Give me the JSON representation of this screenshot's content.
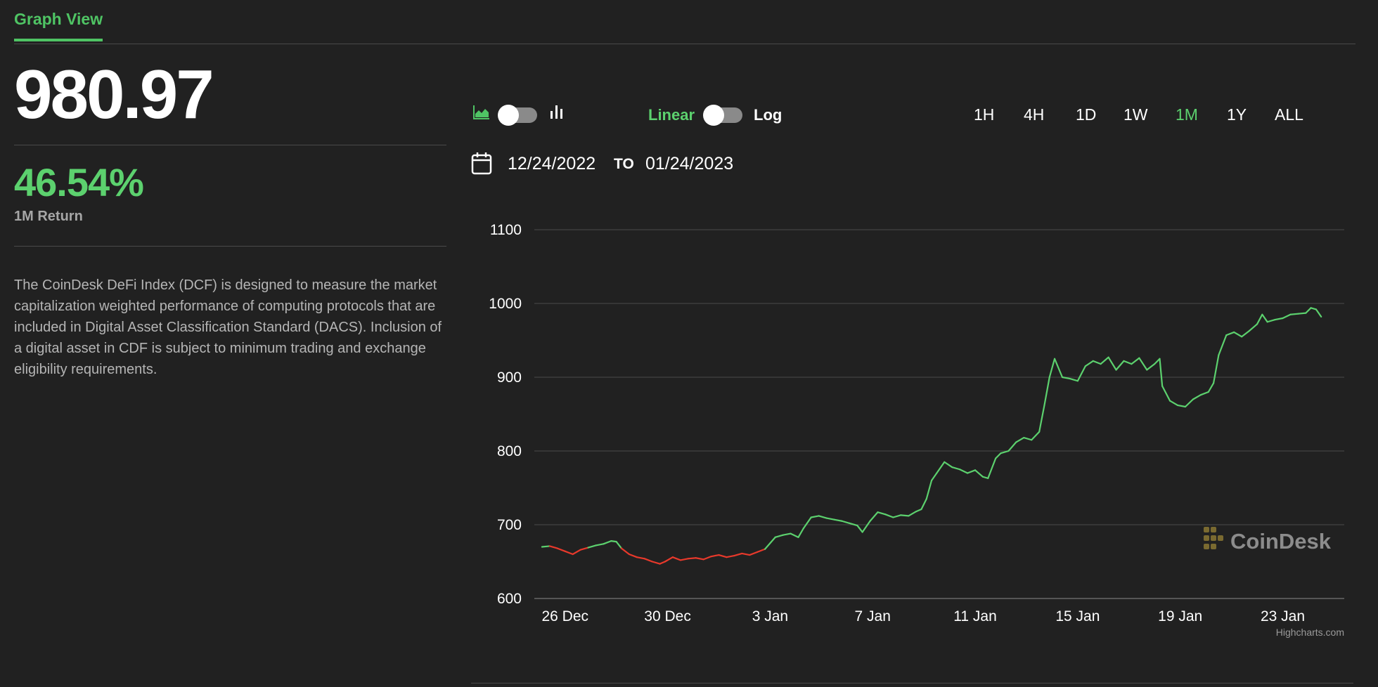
{
  "tab": {
    "label": "Graph View"
  },
  "summary": {
    "price": "980.97",
    "return_value": "46.54%",
    "return_label": "1M Return",
    "description": "The CoinDesk DeFi Index (DCF) is designed to measure the market capitalization weighted performance of computing protocols that are included in Digital Asset Classification Standard (DACS). Inclusion of a digital asset in CDF is subject to minimum trading and exchange eligibility requirements."
  },
  "controls": {
    "area_icon": "area-chart-icon",
    "bar_icon": "bar-chart-icon",
    "scale_linear": "Linear",
    "scale_log": "Log",
    "ranges": [
      "1H",
      "4H",
      "1D",
      "1W",
      "1M",
      "1Y",
      "ALL"
    ],
    "active_range": "1M"
  },
  "date_range": {
    "calendar_icon": "calendar-icon",
    "from": "12/24/2022",
    "separator": "TO",
    "to": "01/24/2023"
  },
  "colors": {
    "up": "#5cd16e",
    "down": "#e8392b",
    "accent": "#4fc464",
    "background": "#212121"
  },
  "chart_data": {
    "type": "line",
    "ylim": [
      600,
      1100
    ],
    "yticks": [
      "600",
      "700",
      "800",
      "900",
      "1000",
      "1100"
    ],
    "xticks": [
      "26 Dec",
      "30 Dec",
      "3 Jan",
      "7 Jan",
      "11 Jan",
      "15 Jan",
      "19 Jan",
      "23 Jan"
    ],
    "xtick_days": [
      2,
      6,
      10,
      14,
      18,
      22,
      26,
      30
    ],
    "x_domain": [
      0.8,
      32.4
    ],
    "grid": true,
    "watermark": "CoinDesk",
    "credits": "Highcharts.com",
    "series": [
      {
        "color_rule": "red below starting value, green above",
        "baseline": 670,
        "points": [
          [
            1.1,
            670
          ],
          [
            1.4,
            671
          ],
          [
            1.7,
            668
          ],
          [
            2.0,
            664
          ],
          [
            2.3,
            660
          ],
          [
            2.6,
            666
          ],
          [
            2.9,
            669
          ],
          [
            3.2,
            672
          ],
          [
            3.5,
            674
          ],
          [
            3.8,
            678
          ],
          [
            4.0,
            677
          ],
          [
            4.2,
            668
          ],
          [
            4.5,
            660
          ],
          [
            4.8,
            656
          ],
          [
            5.1,
            654
          ],
          [
            5.4,
            650
          ],
          [
            5.7,
            647
          ],
          [
            5.9,
            650
          ],
          [
            6.2,
            656
          ],
          [
            6.5,
            652
          ],
          [
            6.8,
            654
          ],
          [
            7.1,
            655
          ],
          [
            7.4,
            653
          ],
          [
            7.7,
            657
          ],
          [
            8.0,
            659
          ],
          [
            8.3,
            656
          ],
          [
            8.6,
            658
          ],
          [
            8.9,
            661
          ],
          [
            9.2,
            659
          ],
          [
            9.5,
            663
          ],
          [
            9.8,
            667
          ],
          [
            10.0,
            675
          ],
          [
            10.2,
            683
          ],
          [
            10.5,
            686
          ],
          [
            10.8,
            688
          ],
          [
            11.1,
            683
          ],
          [
            11.3,
            695
          ],
          [
            11.6,
            710
          ],
          [
            11.9,
            712
          ],
          [
            12.2,
            709
          ],
          [
            12.5,
            707
          ],
          [
            12.8,
            705
          ],
          [
            13.1,
            702
          ],
          [
            13.4,
            699
          ],
          [
            13.6,
            690
          ],
          [
            13.9,
            705
          ],
          [
            14.2,
            717
          ],
          [
            14.5,
            714
          ],
          [
            14.8,
            710
          ],
          [
            15.1,
            713
          ],
          [
            15.4,
            712
          ],
          [
            15.7,
            718
          ],
          [
            15.9,
            721
          ],
          [
            16.1,
            735
          ],
          [
            16.3,
            760
          ],
          [
            16.5,
            770
          ],
          [
            16.8,
            785
          ],
          [
            17.1,
            778
          ],
          [
            17.4,
            775
          ],
          [
            17.7,
            770
          ],
          [
            18.0,
            774
          ],
          [
            18.3,
            765
          ],
          [
            18.5,
            763
          ],
          [
            18.8,
            790
          ],
          [
            19.0,
            797
          ],
          [
            19.3,
            800
          ],
          [
            19.6,
            812
          ],
          [
            19.9,
            818
          ],
          [
            20.2,
            815
          ],
          [
            20.5,
            826
          ],
          [
            20.7,
            862
          ],
          [
            20.9,
            900
          ],
          [
            21.1,
            925
          ],
          [
            21.4,
            900
          ],
          [
            21.7,
            898
          ],
          [
            22.0,
            895
          ],
          [
            22.3,
            915
          ],
          [
            22.6,
            922
          ],
          [
            22.9,
            918
          ],
          [
            23.2,
            927
          ],
          [
            23.5,
            910
          ],
          [
            23.8,
            922
          ],
          [
            24.1,
            918
          ],
          [
            24.4,
            926
          ],
          [
            24.7,
            910
          ],
          [
            25.0,
            918
          ],
          [
            25.2,
            925
          ],
          [
            25.3,
            888
          ],
          [
            25.6,
            868
          ],
          [
            25.9,
            862
          ],
          [
            26.2,
            860
          ],
          [
            26.5,
            870
          ],
          [
            26.8,
            876
          ],
          [
            27.1,
            880
          ],
          [
            27.3,
            892
          ],
          [
            27.5,
            930
          ],
          [
            27.8,
            957
          ],
          [
            28.1,
            961
          ],
          [
            28.4,
            955
          ],
          [
            28.7,
            963
          ],
          [
            29.0,
            972
          ],
          [
            29.2,
            985
          ],
          [
            29.4,
            975
          ],
          [
            29.7,
            978
          ],
          [
            30.0,
            980
          ],
          [
            30.3,
            985
          ],
          [
            30.6,
            986
          ],
          [
            30.9,
            987
          ],
          [
            31.1,
            994
          ],
          [
            31.3,
            992
          ],
          [
            31.5,
            982
          ]
        ]
      }
    ]
  }
}
